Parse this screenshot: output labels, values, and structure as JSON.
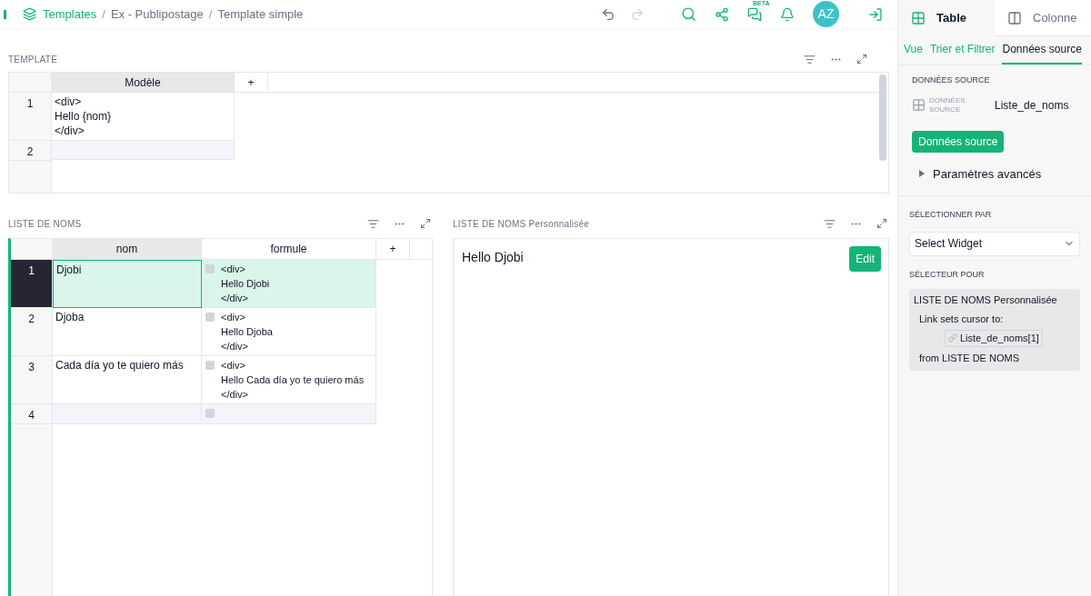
{
  "breadcrumb": [
    "Templates",
    "Ex - Publipostage",
    "Template simple"
  ],
  "breadcrumb_separator": "/",
  "top_bar": {
    "beta_badge": "BETA",
    "avatar": "AZ"
  },
  "template_widget": {
    "title": "TEMPLATE",
    "columns": [
      "Modèle",
      "+"
    ],
    "rows": [
      {
        "number": "1",
        "modele": "<div>\nHello {nom}\n</div>"
      },
      {
        "number": "2"
      }
    ]
  },
  "names_widget": {
    "title": "LISTE DE NOMS",
    "columns": [
      "nom",
      "formule",
      "+"
    ],
    "rows": [
      {
        "number": "1",
        "selected": true,
        "new": false,
        "nom": "Djobi",
        "formule": "<div>\nHello Djobi\n</div>"
      },
      {
        "number": "2",
        "selected": false,
        "new": false,
        "nom": "Djoba",
        "formule": "<div>\nHello Djoba\n</div>"
      },
      {
        "number": "3",
        "selected": false,
        "new": false,
        "nom": "Cada día yo te quiero más",
        "formule": "<div>\nHello Cada día yo te quiero más\n</div>"
      },
      {
        "number": "4",
        "selected": false,
        "new": true
      }
    ]
  },
  "custom_widget": {
    "title": "LISTE DE NOMS Personnalisée",
    "content": "Hello Djobi",
    "edit_button": "Edit"
  },
  "right_panel": {
    "tabs": [
      {
        "label": "Table",
        "selected": true
      },
      {
        "label": "Colonne",
        "selected": false
      }
    ],
    "subtabs": [
      {
        "label": "Vue",
        "selected": false
      },
      {
        "label": "Trier et Filtrer",
        "selected": false
      },
      {
        "label": "Données source",
        "selected": true
      }
    ],
    "source_heading": "DONNÉES SOURCE",
    "source_icon_label": "DONNÉES SOURCE",
    "source_table": "Liste_de_noms",
    "source_button": "Données source",
    "advanced": "Paramètres avancés",
    "select_by_heading": "SÉLECTIONNER PAR",
    "select_by_value": "Select Widget",
    "selector_for_heading": "SÉLECTEUR POUR",
    "selector_box": {
      "widget": "LISTE DE NOMS Personnalisée",
      "link_text": "Link sets cursor to:",
      "link_target": "Liste_de_noms[1]",
      "from": "from LISTE DE NOMS"
    }
  }
}
